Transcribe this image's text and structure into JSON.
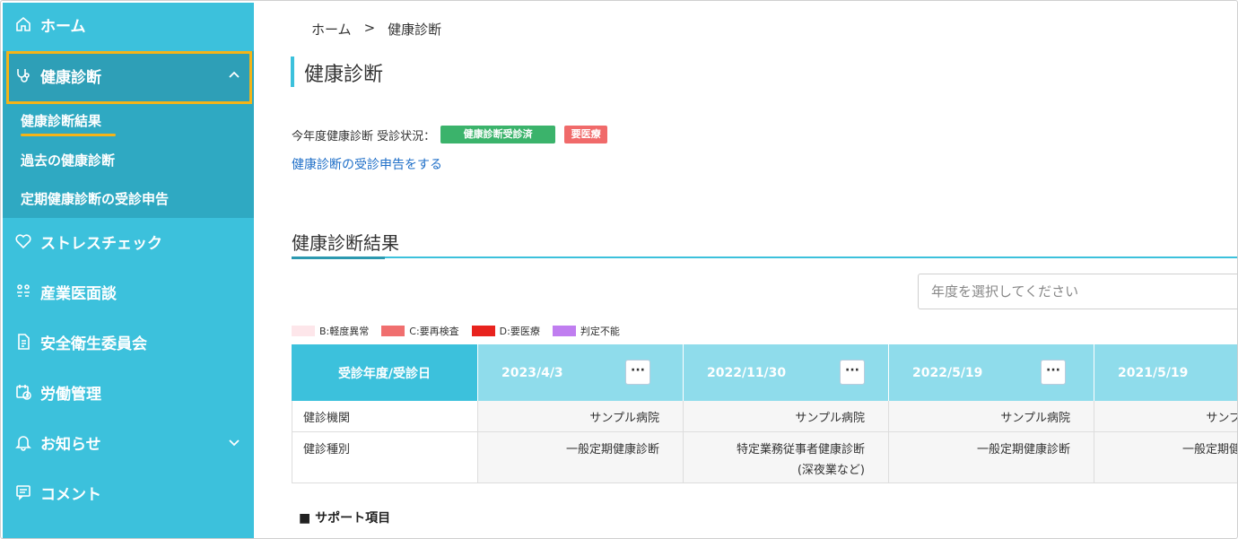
{
  "sidebar": {
    "items": [
      {
        "label": "ホーム",
        "icon": "home-icon"
      },
      {
        "label": "健康診断",
        "icon": "stethoscope-icon"
      },
      {
        "label": "ストレスチェック",
        "icon": "heart-icon"
      },
      {
        "label": "産業医面談",
        "icon": "people-icon"
      },
      {
        "label": "安全衛生委員会",
        "icon": "document-icon"
      },
      {
        "label": "労働管理",
        "icon": "calendar-clock-icon"
      },
      {
        "label": "お知らせ",
        "icon": "bell-icon"
      },
      {
        "label": "コメント",
        "icon": "comment-icon"
      }
    ],
    "sub_items": [
      {
        "label": "健康診断結果"
      },
      {
        "label": "過去の健康診断"
      },
      {
        "label": "定期健康診断の受診申告"
      }
    ]
  },
  "breadcrumb": {
    "home": "ホーム",
    "separator": ">",
    "current": "健康診断"
  },
  "page": {
    "title": "健康診断"
  },
  "status": {
    "label": "今年度健康診断 受診状況：",
    "badge_status": "健康診断受診済",
    "badge_level": "要医療",
    "link": "健康診断の受診申告をする"
  },
  "results": {
    "title": "健康診断結果",
    "select_placeholder": "年度を選択してください",
    "legend": [
      {
        "label": "B:軽度異常",
        "color": "#fde6ea"
      },
      {
        "label": "C:要再検査",
        "color": "#f06f6f"
      },
      {
        "label": "D:要医療",
        "color": "#e8231e"
      },
      {
        "label": "判定不能",
        "color": "#c07ef0"
      }
    ],
    "header_first": "受診年度/受診日",
    "more_label": "···",
    "dates": [
      "2023/4/3",
      "2022/11/30",
      "2022/5/19",
      "2021/5/19"
    ],
    "rows": [
      {
        "label": "健診機関",
        "values": [
          "サンプル病院",
          "サンプル病院",
          "サンプル病院",
          "サンプル病院"
        ]
      },
      {
        "label": "健診種別",
        "values": [
          "一般定期健康診断",
          "特定業務従事者健康診断",
          "一般定期健康診断",
          "一般定期健康診断"
        ],
        "sub": [
          "",
          "(深夜業など)",
          "",
          ""
        ]
      }
    ],
    "support_title": "■ サポート項目"
  }
}
